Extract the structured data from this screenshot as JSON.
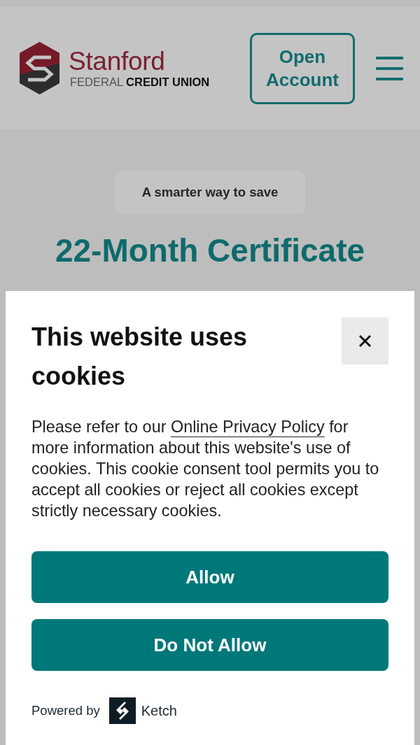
{
  "header": {
    "logo": {
      "name": "Stanford",
      "tagline": "FEDERAL **CREDIT UNION**"
    },
    "open_account_button": "Open Account"
  },
  "hero": {
    "eyebrow": "A smarter way to save",
    "title": "22-Month Certificate"
  },
  "cookie_dialog": {
    "title": "This website uses cookies",
    "body_before_link": "Please refer to our",
    "link": "Online Privacy Policy",
    "body_after_link": "for more information about this website's use of cookies. This cookie consent tool permits you to accept all cookies or reject all cookies except strictly necessary cookies.",
    "buttons": [
      "Allow",
      "Do Not Allow"
    ],
    "powered_by": "Powered by",
    "brand": "Ketch"
  }
}
